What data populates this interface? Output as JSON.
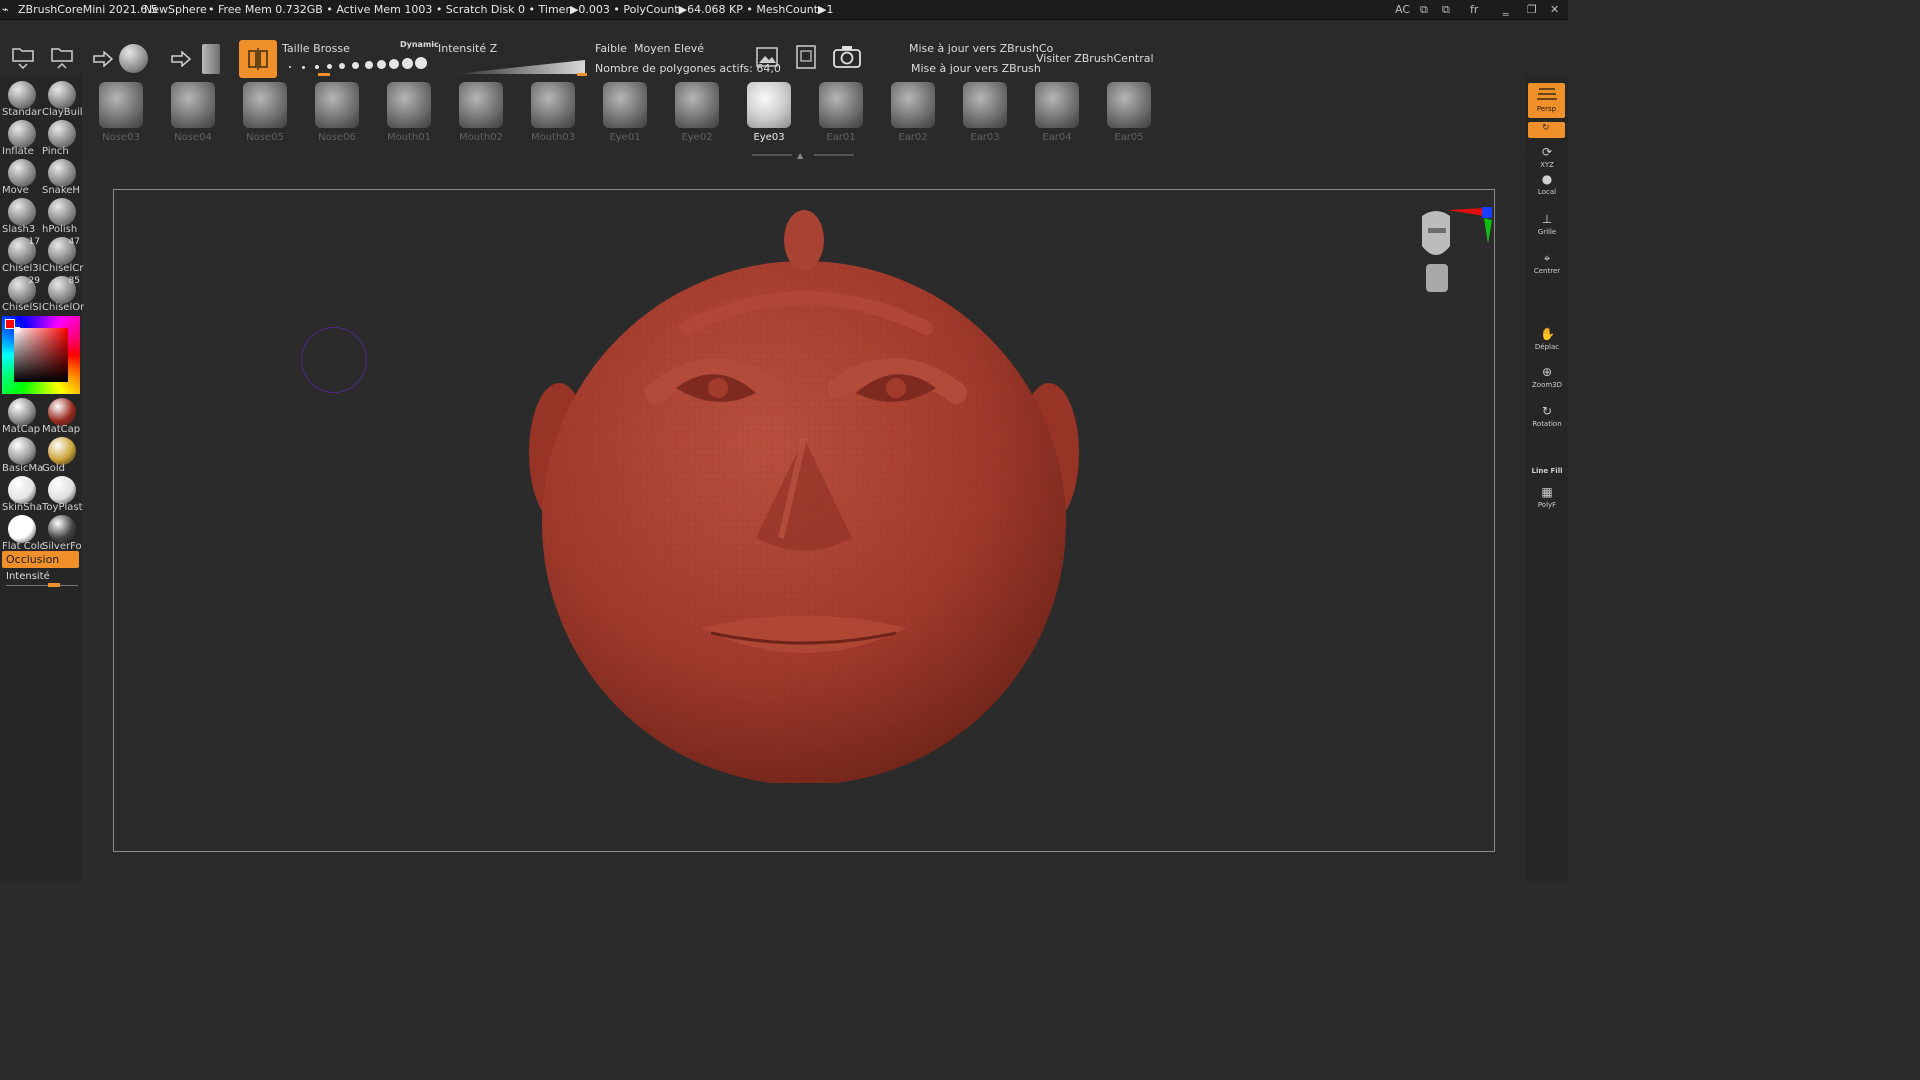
{
  "titlebar": {
    "app": "ZBrushCoreMini 2021.6.5",
    "file": "NewSphere",
    "stats": "• Free Mem 0.732GB • Active Mem 1003 • Scratch Disk 0 •  Timer▶0.003 • PolyCount▶64.068 KP  • MeshCount▶1",
    "right_ac": "AC",
    "right_lang": "fr"
  },
  "toolbar": {
    "taille_brosse": "Taille Brosse",
    "dynamic": "Dynamic",
    "intensite_z": "Intensité Z",
    "faible": "Faible",
    "moyen": "Moyen",
    "eleve": "Elevé",
    "polygones": "Nombre de polygones actifs: 64,0",
    "maj_zbrushco": "Mise à jour vers ZBrushCo",
    "maj_zbrush": "Mise à jour vers ZBrush",
    "visiter": "Visiter ZBrushCentral",
    "brush_size_level": 0.25,
    "intensity_level": 1.0
  },
  "brush_palette": [
    {
      "label": "Nose03"
    },
    {
      "label": "Nose04"
    },
    {
      "label": "Nose05"
    },
    {
      "label": "Nose06"
    },
    {
      "label": "Mouth01"
    },
    {
      "label": "Mouth02"
    },
    {
      "label": "Mouth03"
    },
    {
      "label": "Eye01"
    },
    {
      "label": "Eye02"
    },
    {
      "label": "Eye03",
      "active": true
    },
    {
      "label": "Ear01"
    },
    {
      "label": "Ear02"
    },
    {
      "label": "Ear03"
    },
    {
      "label": "Ear04"
    },
    {
      "label": "Ear05"
    }
  ],
  "left_brushes": [
    {
      "label": "Standar"
    },
    {
      "label": "ClayBuil"
    },
    {
      "label": "Inflate"
    },
    {
      "label": "Pinch"
    },
    {
      "label": "Move"
    },
    {
      "label": "SnakeH"
    },
    {
      "label": "Slash3"
    },
    {
      "label": "hPolish"
    },
    {
      "label": "Chisel3I",
      "count": "17"
    },
    {
      "label": "ChiselCr",
      "count": "47"
    },
    {
      "label": "ChiselSI",
      "count": "29"
    },
    {
      "label": "ChiselOr",
      "count": "85"
    }
  ],
  "materials": [
    {
      "label": "MatCap",
      "color": "#8c8c8c"
    },
    {
      "label": "MatCap",
      "color": "#9a2a1e"
    },
    {
      "label": "BasicMa",
      "color": "#9a9a9a"
    },
    {
      "label": "Gold",
      "color": "#c9a236"
    },
    {
      "label": "SkinSha",
      "color": "#e4e4e4"
    },
    {
      "label": "ToyPlast",
      "color": "#e0e0e0"
    },
    {
      "label": "Flat Colo",
      "color": "#ffffff"
    },
    {
      "label": "SilverFo",
      "color": "#444444"
    }
  ],
  "occlusion": "Occlusion",
  "intensite": "Intensité",
  "right_shelf": [
    {
      "label": "Persp"
    },
    {
      "label": ""
    },
    {
      "label": "XYZ"
    },
    {
      "label": "Local"
    },
    {
      "label": "Grille"
    },
    {
      "label": "Centrer"
    },
    {
      "label": "Déplac"
    },
    {
      "label": "Zoom3D"
    },
    {
      "label": "Rotation"
    },
    {
      "label": "Line Fill"
    },
    {
      "label": "PolyF"
    }
  ],
  "colors": {
    "accent": "#f0902a",
    "model": "#a23a2c"
  }
}
